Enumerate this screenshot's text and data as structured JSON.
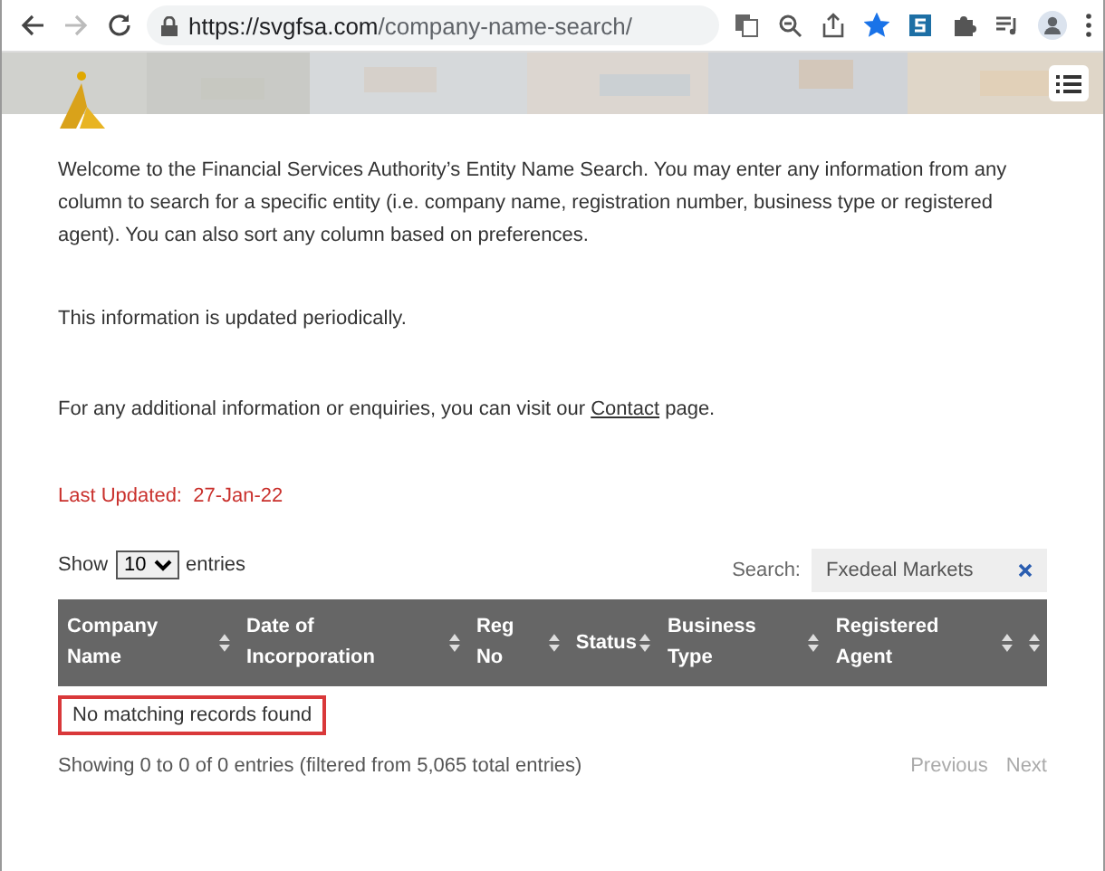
{
  "browser": {
    "url_host": "https://svgfsa.com",
    "url_path": "/company-name-search/",
    "back_disabled": false,
    "forward_disabled": true,
    "bookmarked": true
  },
  "intro": "Welcome to the Financial Services Authority’s Entity Name Search. You may enter any information from any column to search for a specific entity (i.e. company name, registration number, business type or registered agent). You can also sort any column based on preferences.",
  "update_note": "This information is updated periodically.",
  "contact": {
    "before": "For any additional information or enquiries, you can visit our ",
    "link": "Contact",
    "after": " page."
  },
  "last_updated": {
    "label": "Last Updated:",
    "value": "27-Jan-22"
  },
  "length": {
    "label_before": "Show",
    "value": "10",
    "label_after": "entries"
  },
  "search": {
    "label": "Search:",
    "value": "Fxedeal Markets"
  },
  "table": {
    "columns": [
      {
        "label": "Company Name"
      },
      {
        "label": "Date of Incorporation"
      },
      {
        "label": "Reg No"
      },
      {
        "label": "Status"
      },
      {
        "label": "Business Type"
      },
      {
        "label": "Registered Agent"
      },
      {}
    ],
    "empty_message": "No matching records found",
    "empty_highlighted": true
  },
  "info": "Showing 0 to 0 of 0 entries (filtered from 5,065 total entries)",
  "pagination": {
    "previous": "Previous",
    "next": "Next",
    "previous_disabled": true,
    "next_disabled": true
  }
}
